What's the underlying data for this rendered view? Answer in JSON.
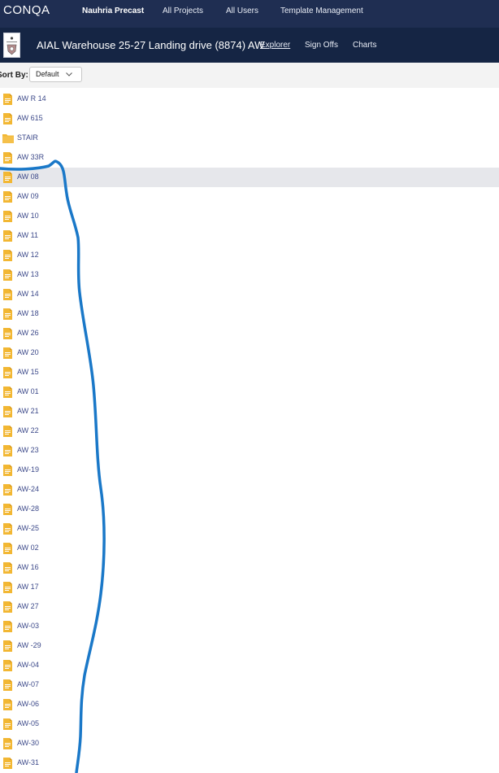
{
  "topbar": {
    "brand": "CONQA",
    "nav": [
      {
        "label": "Nauhria Precast",
        "active": true
      },
      {
        "label": "All Projects",
        "active": false
      },
      {
        "label": "All Users",
        "active": false
      },
      {
        "label": "Template Management",
        "active": false
      }
    ]
  },
  "project": {
    "logo_icon": "company-logo",
    "title": "AIAL Warehouse 25-27 Landing drive (8874) AW",
    "tabs": [
      {
        "label": "Explorer",
        "active": true
      },
      {
        "label": "Sign Offs",
        "active": false
      },
      {
        "label": "Charts",
        "active": false
      }
    ]
  },
  "sort": {
    "label": "Sort By:",
    "value": "Default"
  },
  "colors": {
    "topbar": "#1f2e52",
    "project_bar": "#152544",
    "item_icon": "#f2b733",
    "item_text": "#3d4a8a",
    "annotation_stroke": "#1a78c8",
    "selected_row": "#e6e7eb"
  },
  "items": [
    {
      "label": "AW R 14",
      "icon": "document-icon"
    },
    {
      "label": "AW 615",
      "icon": "document-icon"
    },
    {
      "label": "STAIR",
      "icon": "folder-icon"
    },
    {
      "label": "AW 33R",
      "icon": "document-icon"
    },
    {
      "label": "AW 08",
      "icon": "document-icon",
      "selected": true
    },
    {
      "label": "AW 09",
      "icon": "document-icon"
    },
    {
      "label": "AW 10",
      "icon": "document-icon"
    },
    {
      "label": "AW 11",
      "icon": "document-icon"
    },
    {
      "label": "AW 12",
      "icon": "document-icon"
    },
    {
      "label": "AW 13",
      "icon": "document-icon"
    },
    {
      "label": "AW 14",
      "icon": "document-icon"
    },
    {
      "label": "AW 18",
      "icon": "document-icon"
    },
    {
      "label": "AW 26",
      "icon": "document-icon"
    },
    {
      "label": "AW 20",
      "icon": "document-icon"
    },
    {
      "label": "AW 15",
      "icon": "document-icon"
    },
    {
      "label": "AW 01",
      "icon": "document-icon"
    },
    {
      "label": "AW 21",
      "icon": "document-icon"
    },
    {
      "label": "AW 22",
      "icon": "document-icon"
    },
    {
      "label": "AW 23",
      "icon": "document-icon"
    },
    {
      "label": "AW-19",
      "icon": "document-icon"
    },
    {
      "label": "AW-24",
      "icon": "document-icon"
    },
    {
      "label": "AW-28",
      "icon": "document-icon"
    },
    {
      "label": "AW-25",
      "icon": "document-icon"
    },
    {
      "label": "AW 02",
      "icon": "document-icon"
    },
    {
      "label": "AW 16",
      "icon": "document-icon"
    },
    {
      "label": "AW 17",
      "icon": "document-icon"
    },
    {
      "label": "AW 27",
      "icon": "document-icon"
    },
    {
      "label": "AW-03",
      "icon": "document-icon"
    },
    {
      "label": "AW -29",
      "icon": "document-icon"
    },
    {
      "label": "AW-04",
      "icon": "document-icon"
    },
    {
      "label": "AW-07",
      "icon": "document-icon"
    },
    {
      "label": "AW-06",
      "icon": "document-icon"
    },
    {
      "label": "AW-05",
      "icon": "document-icon"
    },
    {
      "label": "AW-30",
      "icon": "document-icon"
    },
    {
      "label": "AW-31",
      "icon": "document-icon"
    }
  ]
}
